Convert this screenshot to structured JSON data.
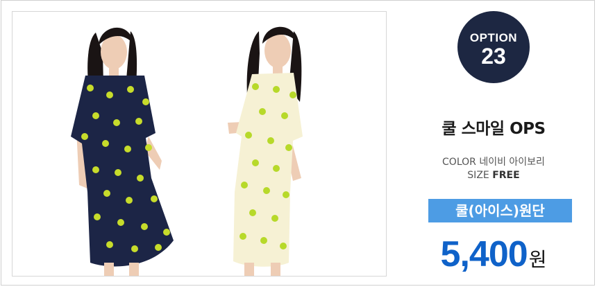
{
  "option": {
    "label": "OPTION",
    "number": "23"
  },
  "product": {
    "name": "쿨 스마일 OPS",
    "color_label": "COLOR",
    "colors": "네이비 아이보리",
    "size_label": "SIZE",
    "size_value": "FREE",
    "fabric_tag": "쿨(아이스)원단",
    "price": "5,400",
    "price_unit": "원"
  },
  "photos": [
    {
      "dress_color": "#1c2546",
      "pattern_color": "#c7dc2b"
    },
    {
      "dress_color": "#f6f1d4",
      "pattern_color": "#b7d92a"
    }
  ],
  "colors": {
    "badge": "#1d2742",
    "fabric_tag": "#4d9ce4",
    "price": "#0f62c9"
  }
}
